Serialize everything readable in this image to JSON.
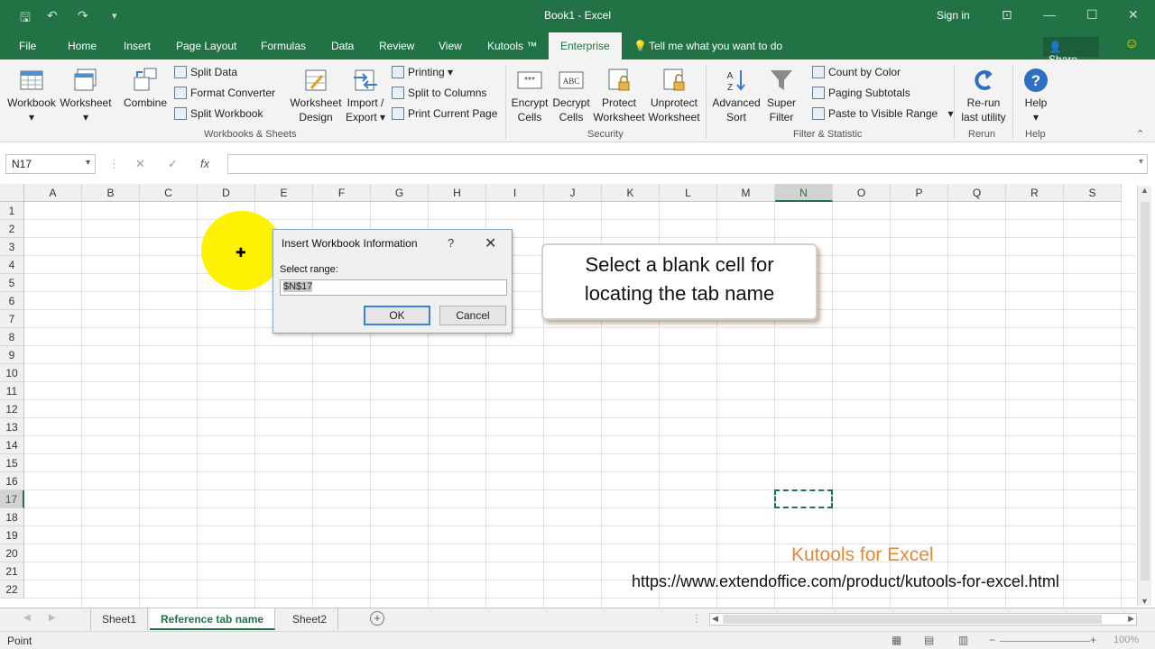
{
  "titlebar": {
    "title": "Book1 - Excel",
    "signin": "Sign in"
  },
  "menu": {
    "tabs": [
      "File",
      "Home",
      "Insert",
      "Page Layout",
      "Formulas",
      "Data",
      "Review",
      "View",
      "Kutools ™",
      "Enterprise"
    ],
    "active_tab": "Enterprise",
    "tell_me": "Tell me what you want to do",
    "share": "Share"
  },
  "ribbon": {
    "workbooks": {
      "workbook": "Workbook",
      "worksheet": "Worksheet",
      "combine": "Combine",
      "split_data": "Split Data",
      "format_converter": "Format Converter",
      "split_workbook": "Split Workbook",
      "worksheet_design_1": "Worksheet",
      "worksheet_design_2": "Design",
      "import_export_1": "Import /",
      "import_export_2": "Export",
      "printing": "Printing",
      "split_to_columns": "Split to Columns",
      "print_current_page": "Print Current Page",
      "group_label": "Workbooks & Sheets"
    },
    "security": {
      "encrypt_1": "Encrypt",
      "encrypt_2": "Cells",
      "decrypt_1": "Decrypt",
      "decrypt_2": "Cells",
      "protect_1": "Protect",
      "protect_2": "Worksheet",
      "unprotect_1": "Unprotect",
      "unprotect_2": "Worksheet",
      "group_label": "Security"
    },
    "filter": {
      "advanced_1": "Advanced",
      "advanced_2": "Sort",
      "super_1": "Super",
      "super_2": "Filter",
      "count_by_color": "Count by Color",
      "paging_subtotals": "Paging Subtotals",
      "paste_visible": "Paste to Visible Range",
      "group_label": "Filter & Statistic"
    },
    "rerun": {
      "label_1": "Re-run",
      "label_2": "last utility",
      "group_label": "Rerun"
    },
    "help": {
      "label": "Help",
      "group_label": "Help"
    }
  },
  "formula_bar": {
    "name_box": "N17",
    "formula": ""
  },
  "grid": {
    "columns": [
      "A",
      "B",
      "C",
      "D",
      "E",
      "F",
      "G",
      "H",
      "I",
      "J",
      "K",
      "L",
      "M",
      "N",
      "O",
      "P",
      "Q",
      "R",
      "S"
    ],
    "rows": [
      "1",
      "2",
      "3",
      "4",
      "5",
      "6",
      "7",
      "8",
      "9",
      "10",
      "11",
      "12",
      "13",
      "14",
      "15",
      "16",
      "17",
      "18",
      "19",
      "20",
      "21",
      "22"
    ],
    "selected_column": "N",
    "selected_row": "17"
  },
  "dialog": {
    "title": "Insert Workbook Information",
    "help": "?",
    "close": "✕",
    "label": "Select range:",
    "value": "$N$17",
    "ok": "OK",
    "cancel": "Cancel"
  },
  "callout": {
    "line1": "Select a blank cell for",
    "line2": "locating the tab name"
  },
  "watermark": {
    "brand": "Kutools for Excel",
    "url": "https://www.extendoffice.com/product/kutools-for-excel.html"
  },
  "sheets": {
    "tabs": [
      "Sheet1",
      "Reference tab name",
      "Sheet2"
    ],
    "active": "Reference tab name"
  },
  "status": {
    "mode": "Point",
    "zoom": "100%"
  }
}
